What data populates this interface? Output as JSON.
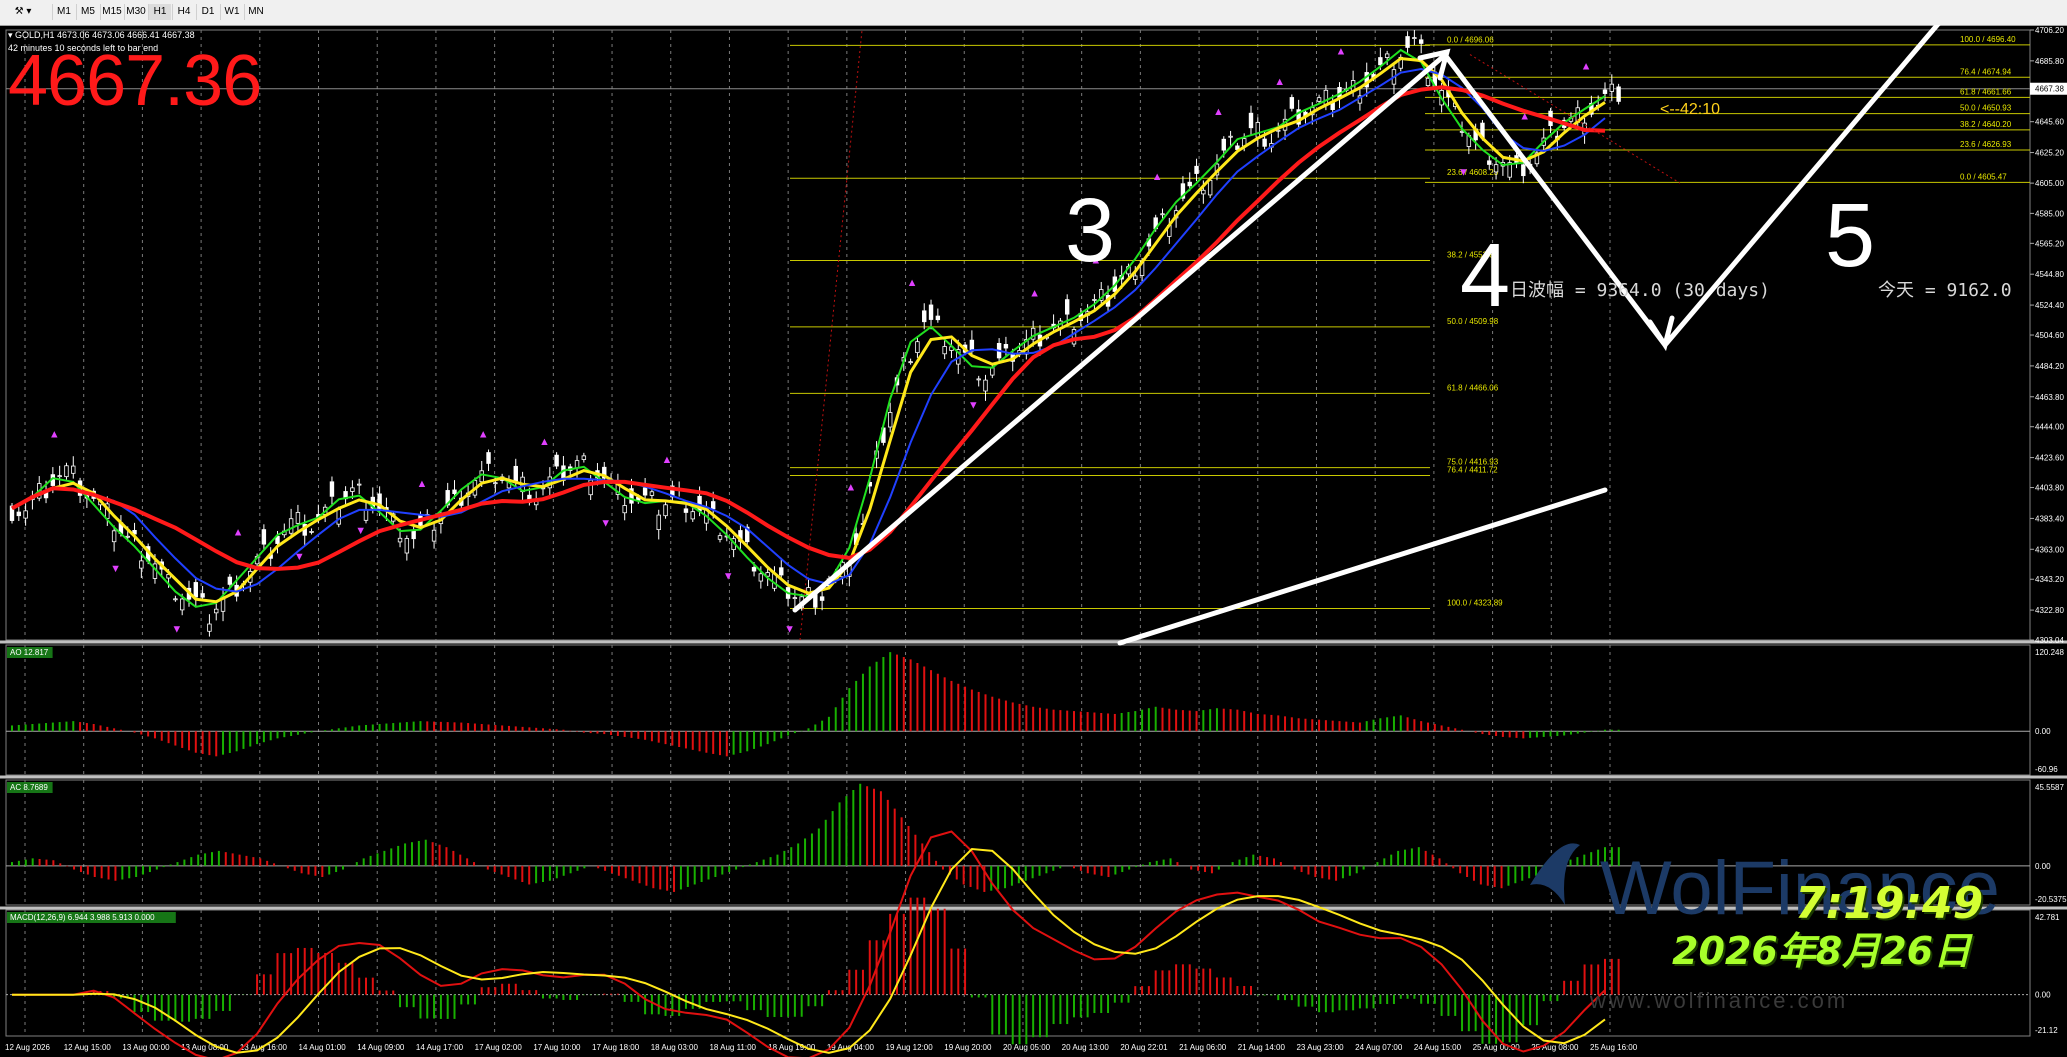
{
  "toolbar": {
    "timeframes": [
      "M1",
      "M5",
      "M15",
      "M30",
      "H1",
      "H4",
      "D1",
      "W1",
      "MN"
    ],
    "active": "H1"
  },
  "overlay": {
    "symbol_line": "▾ GOLD,H1  4673.06 4673.06 4666.41 4667.38",
    "timer_text": "42 minutes 10 seconds left to bar end",
    "big_price": "4667.36",
    "amp_text": "日波幅 = 9364.0  (30 days)",
    "today_text": "今天 = 9162.0",
    "countdown": "<--42:10",
    "clock": "7:19:49",
    "date": "2026年8月26日",
    "watermark": "WolFinance",
    "watermark2": "www.wolfinance.com",
    "wave_labels": [
      "3",
      "4",
      "5"
    ]
  },
  "chart_data": {
    "type": "candlestick",
    "symbol": "GOLD",
    "timeframe": "H1",
    "last_price": 4667.38,
    "ohlc": {
      "open": 4673.06,
      "high": 4673.06,
      "low": 4666.41,
      "close": 4667.38
    },
    "price_axis": {
      "min": 4303.04,
      "max": 4706.2,
      "ticks": [
        4706.2,
        4685.8,
        4665.6,
        4645.6,
        4625.2,
        4605.0,
        4585.0,
        4565.2,
        4544.8,
        4524.4,
        4504.6,
        4484.2,
        4463.8,
        4444.0,
        4423.6,
        4403.8,
        4383.4,
        4363.0,
        4343.2,
        4322.8,
        4303.04
      ],
      "current_label": "4667.38"
    },
    "time_axis": [
      "12 Aug 2026",
      "12 Aug 15:00",
      "13 Aug 00:00",
      "13 Aug 08:00",
      "13 Aug 16:00",
      "14 Aug 01:00",
      "14 Aug 09:00",
      "14 Aug 17:00",
      "17 Aug 02:00",
      "17 Aug 10:00",
      "17 Aug 18:00",
      "18 Aug 03:00",
      "18 Aug 11:00",
      "18 Aug 19:00",
      "19 Aug 04:00",
      "19 Aug 12:00",
      "19 Aug 20:00",
      "20 Aug 05:00",
      "20 Aug 13:00",
      "20 Aug 22:01",
      "21 Aug 06:00",
      "21 Aug 14:00",
      "23 Aug 23:00",
      "24 Aug 07:00",
      "24 Aug 15:00",
      "25 Aug 00:00",
      "25 Aug 08:00",
      "25 Aug 16:00"
    ],
    "fib_upper": [
      {
        "level": "100.0",
        "price": 4696.4
      },
      {
        "level": "76.4",
        "price": 4674.94
      },
      {
        "level": "61.8",
        "price": 4661.66
      },
      {
        "level": "50.0",
        "price": 4650.93
      },
      {
        "level": "38.2",
        "price": 4640.2
      },
      {
        "level": "23.6",
        "price": 4626.93
      },
      {
        "level": "0.0",
        "price": 4605.47
      }
    ],
    "fib_lower": [
      {
        "level": "0.0",
        "price": 4696.06
      },
      {
        "level": "23.6",
        "price": 4608.23
      },
      {
        "level": "38.2",
        "price": 4553.89
      },
      {
        "level": "50.0",
        "price": 4509.98
      },
      {
        "level": "61.8",
        "price": 4466.06
      },
      {
        "level": "75.0",
        "price": 4416.93
      },
      {
        "level": "76.4",
        "price": 4411.72
      },
      {
        "level": "100.0",
        "price": 4323.89
      }
    ],
    "close_path": [
      4390,
      4405,
      4415,
      4400,
      4385,
      4370,
      4360,
      4340,
      4330,
      4320,
      4335,
      4350,
      4365,
      4380,
      4378,
      4390,
      4402,
      4395,
      4380,
      4370,
      4382,
      4395,
      4410,
      4415,
      4405,
      4398,
      4410,
      4420,
      4415,
      4400,
      4395,
      4392,
      4398,
      4390,
      4380,
      4365,
      4350,
      4338,
      4330,
      4334,
      4348,
      4380,
      4440,
      4485,
      4515,
      4505,
      4490,
      4478,
      4488,
      4500,
      4508,
      4512,
      4520,
      4530,
      4545,
      4565,
      4585,
      4600,
      4610,
      4628,
      4640,
      4636,
      4648,
      4655,
      4660,
      4668,
      4676,
      4688,
      4698,
      4672,
      4650,
      4632,
      4622,
      4612,
      4625,
      4640,
      4650,
      4658,
      4667
    ],
    "indicators": {
      "ao": {
        "label": "AO 12.817",
        "top": "120.248",
        "bottom": "-60.96",
        "zero": "0.00",
        "colors": {
          "up": "#18b000",
          "down": "#e01010"
        },
        "values": [
          8,
          10,
          12,
          14,
          10,
          4,
          -2,
          -10,
          -20,
          -30,
          -35,
          -28,
          -18,
          -10,
          -5,
          0,
          4,
          8,
          10,
          12,
          14,
          13,
          12,
          10,
          8,
          6,
          4,
          2,
          -2,
          -4,
          -8,
          -12,
          -18,
          -24,
          -30,
          -35,
          -28,
          -18,
          -6,
          4,
          20,
          60,
          90,
          110,
          100,
          85,
          70,
          58,
          48,
          40,
          34,
          30,
          28,
          26,
          24,
          28,
          34,
          30,
          28,
          32,
          30,
          24,
          22,
          18,
          16,
          14,
          12,
          18,
          22,
          14,
          8,
          2,
          -4,
          -8,
          -10,
          -8,
          -6,
          -2,
          2
        ]
      },
      "ac": {
        "label": "AC 8.7689",
        "top": "45.5587",
        "bottom": "-20.5375",
        "zero": "0.00",
        "colors": {
          "up": "#18b000",
          "down": "#e01010"
        },
        "values": [
          2,
          4,
          3,
          -2,
          -6,
          -8,
          -6,
          -2,
          2,
          6,
          8,
          6,
          4,
          0,
          -4,
          -6,
          -2,
          4,
          8,
          12,
          14,
          10,
          4,
          -2,
          -6,
          -10,
          -8,
          -4,
          0,
          -4,
          -8,
          -12,
          -14,
          -10,
          -6,
          -2,
          2,
          6,
          12,
          20,
          34,
          44,
          40,
          26,
          12,
          -2,
          -10,
          -14,
          -12,
          -8,
          -4,
          0,
          -4,
          -6,
          -2,
          2,
          4,
          -2,
          -4,
          2,
          6,
          4,
          -2,
          -6,
          -8,
          -4,
          2,
          8,
          10,
          4,
          -4,
          -10,
          -12,
          -8,
          -4,
          2,
          6,
          10
        ]
      },
      "macd": {
        "label": "MACD(12,26,9) 6.944 3.988 5.913 0.000",
        "top": "42.781",
        "bottom": "-21.12",
        "zero": "0.00",
        "colors": {
          "hist_up": "#e01010",
          "hist_down": "#18b000",
          "main": "#e01010",
          "signal": "#ffe81a"
        }
      },
      "ma": {
        "colors": {
          "green": "#20e020",
          "yellow": "#ffe81a",
          "blue": "#2040ff",
          "red": "#ff1a1a"
        }
      }
    }
  }
}
